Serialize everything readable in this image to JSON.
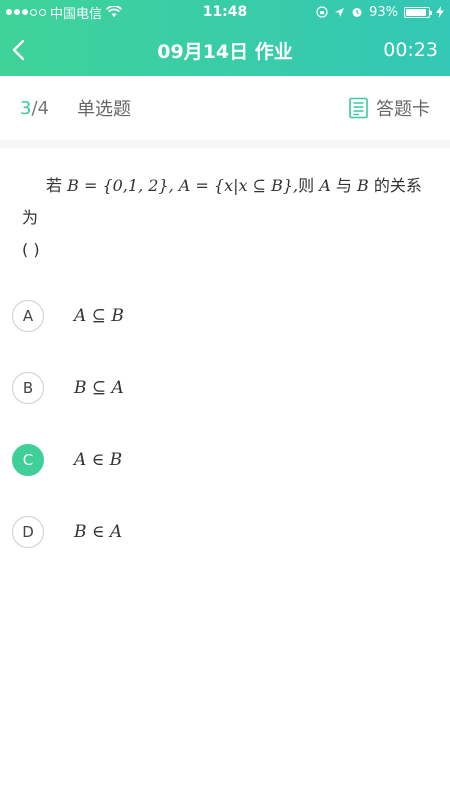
{
  "status_bar": {
    "carrier": "中国电信",
    "time": "11:48",
    "battery": "93%",
    "battery_level": 0.93
  },
  "navbar": {
    "title": "09月14日 作业",
    "timer": "00:23"
  },
  "subbar": {
    "current": "3",
    "total": "/4",
    "type": "单选题",
    "card_label": "答题卡"
  },
  "question": {
    "prefix": "若",
    "expr_b": "B = {0,1, 2}, A = {x|x ⊆ B},",
    "middle": "则",
    "var_a": "A",
    "conj": "与",
    "var_b": "B",
    "suffix": "的关系为",
    "blank": "(   )"
  },
  "options": [
    {
      "letter": "A",
      "expr": "A ⊆ B",
      "selected": false
    },
    {
      "letter": "B",
      "expr": "B ⊆ A",
      "selected": false
    },
    {
      "letter": "C",
      "expr": "A ∈ B",
      "selected": true
    },
    {
      "letter": "D",
      "expr": "B ∈ A",
      "selected": false
    }
  ],
  "colors": {
    "header_start": "#3fd399",
    "header_end": "#33c7b6",
    "accent": "#3fcf98"
  }
}
